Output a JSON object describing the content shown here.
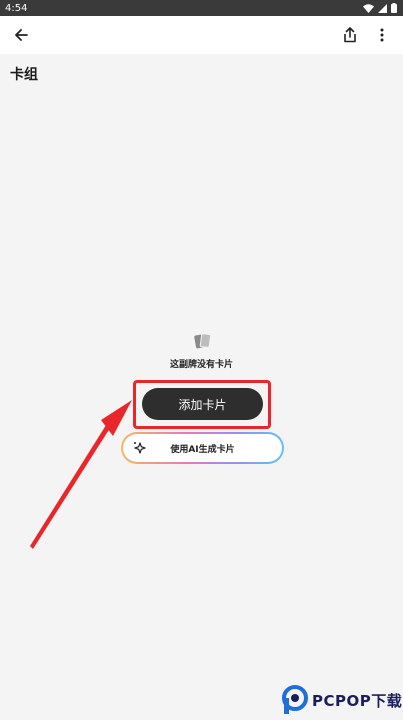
{
  "status_bar": {
    "time": "4:54"
  },
  "app_bar": {
    "back_icon": "arrow-back-icon",
    "share_icon": "share-icon",
    "more_icon": "more-vert-icon"
  },
  "page": {
    "title": "卡组"
  },
  "empty_state": {
    "icon": "cards-icon",
    "message": "这副牌没有卡片"
  },
  "actions": {
    "add_card_label": "添加卡片",
    "ai_generate_label": "使用AI生成卡片",
    "ai_icon": "sparkle-icon"
  },
  "annotation": {
    "highlight_color": "#e9272a"
  },
  "watermark": {
    "text": "PCPOP下载"
  }
}
